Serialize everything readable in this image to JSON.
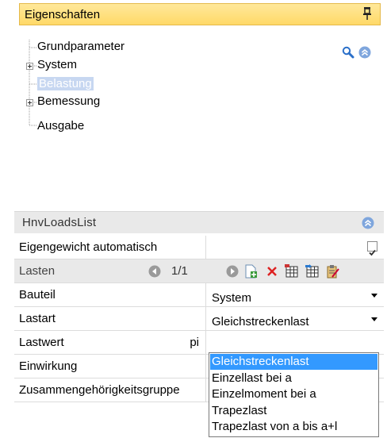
{
  "header": {
    "title": "Eigenschaften"
  },
  "tree": {
    "items": [
      {
        "label": "Grundparameter",
        "expandable": false,
        "selected": false
      },
      {
        "label": "System",
        "expandable": true,
        "selected": false
      },
      {
        "label": "Belastung",
        "expandable": false,
        "selected": true
      },
      {
        "label": "Bemessung",
        "expandable": true,
        "selected": false
      },
      {
        "label": "Ausgabe",
        "expandable": false,
        "selected": false
      }
    ]
  },
  "section": {
    "title": "HnvLoadsList"
  },
  "grid": {
    "eigengewicht": {
      "label": "Eigengewicht automatisch",
      "checked": true
    },
    "lasten": {
      "label": "Lasten",
      "pager": "1/1"
    },
    "bauteil": {
      "label": "Bauteil",
      "value": "System"
    },
    "lastart": {
      "label": "Lastart",
      "value": "Gleichstreckenlast"
    },
    "lastwert": {
      "label": "Lastwert",
      "unit": "pi"
    },
    "einwirkung": {
      "label": "Einwirkung"
    },
    "gruppe": {
      "label": "Zusammengehörigkeitsgruppe"
    }
  },
  "dropdown": {
    "options": [
      "Gleichstreckenlast",
      "Einzellast bei a",
      "Einzelmoment bei a",
      "Trapezlast",
      "Trapezlast von a bis a+l"
    ],
    "selected_index": 0
  },
  "colors": {
    "header_bg": "#ffd968",
    "selection": "#3399ff",
    "tree_selection": "#c7d7f1"
  }
}
